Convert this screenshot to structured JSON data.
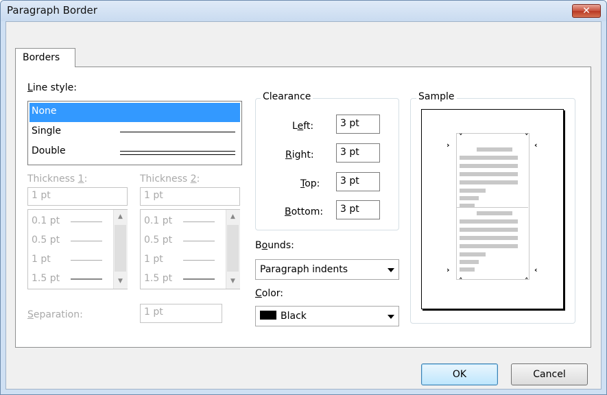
{
  "window": {
    "title": "Paragraph Border",
    "close_glyph": "✕"
  },
  "tabs": [
    {
      "label": "Borders"
    }
  ],
  "line_style": {
    "label": "Line style:",
    "items": [
      {
        "label": "None",
        "selected": true
      },
      {
        "label": "Single"
      },
      {
        "label": "Double"
      }
    ]
  },
  "thickness1": {
    "label": "Thickness 1:",
    "value": "1 pt",
    "options": [
      "0.1 pt",
      "0.5 pt",
      "1 pt",
      "1.5 pt"
    ]
  },
  "thickness2": {
    "label": "Thickness 2:",
    "value": "1 pt",
    "options": [
      "0.1 pt",
      "0.5 pt",
      "1 pt",
      "1.5 pt"
    ]
  },
  "separation": {
    "label": "Separation:",
    "value": "1 pt"
  },
  "clearance": {
    "label": "Clearance",
    "left": {
      "label": "Left:",
      "value": "3 pt"
    },
    "right": {
      "label": "Right:",
      "value": "3 pt"
    },
    "top": {
      "label": "Top:",
      "value": "3 pt"
    },
    "bottom": {
      "label": "Bottom:",
      "value": "3 pt"
    }
  },
  "bounds": {
    "label": "Bounds:",
    "value": "Paragraph indents"
  },
  "color": {
    "label": "Color:",
    "value": "Black",
    "swatch": "#000000"
  },
  "sample": {
    "label": "Sample"
  },
  "buttons": {
    "ok": "OK",
    "cancel": "Cancel"
  },
  "colors": {
    "selection": "#3399ff",
    "disabled_text": "#a9a9a9"
  }
}
